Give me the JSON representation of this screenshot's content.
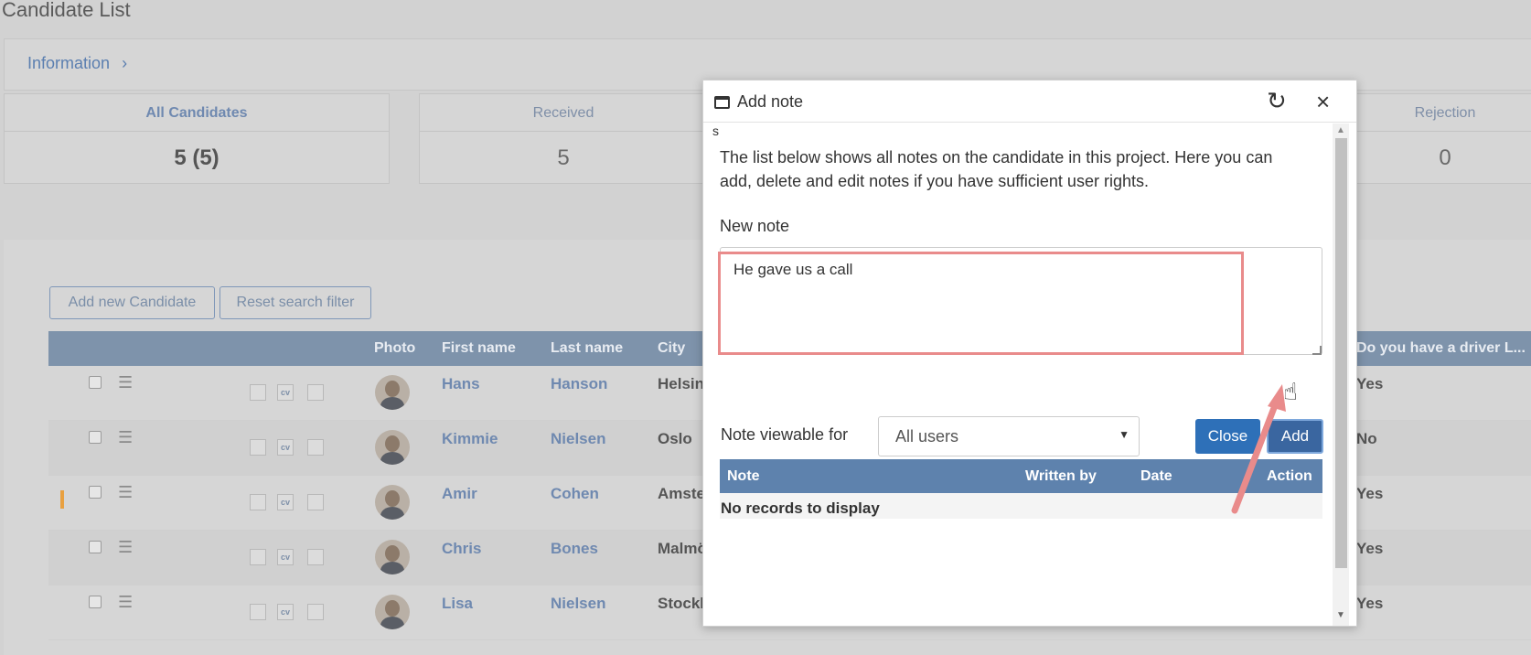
{
  "page": {
    "title": "Candidate List"
  },
  "info_bar": {
    "link_label": "Information",
    "chevron": "›"
  },
  "stats": [
    {
      "label": "All Candidates",
      "value": "5 (5)"
    },
    {
      "label": "Received",
      "value": "5"
    },
    {
      "label": "Rejection",
      "value": "0"
    }
  ],
  "toolbar": {
    "add_candidate_label": "Add new Candidate",
    "reset_filter_label": "Reset search filter"
  },
  "table": {
    "columns": [
      "Photo",
      "First name",
      "Last name",
      "City",
      "Do you have a driver L..."
    ],
    "rows": [
      {
        "first": "Hans",
        "last": "Hanson",
        "city": "Helsin",
        "driver": "Yes"
      },
      {
        "first": "Kimmie",
        "last": "Nielsen",
        "city": "Oslo",
        "driver": "No"
      },
      {
        "first": "Amir",
        "last": "Cohen",
        "city": "Amste",
        "driver": "Yes"
      },
      {
        "first": "Chris",
        "last": "Bones",
        "city": "Malmö",
        "driver": "Yes"
      },
      {
        "first": "Lisa",
        "last": "Nielsen",
        "city": "Stockl",
        "driver": "Yes"
      }
    ],
    "mini_icons": [
      "",
      "cv",
      ""
    ]
  },
  "modal": {
    "title": "Add note",
    "stray_text": "s",
    "intro": "The list below shows all notes on the candidate in this project. Here you can add, delete and edit notes if you have sufficient user rights.",
    "new_note_label": "New note",
    "note_value": "He gave us a call",
    "viewable_label": "Note viewable for",
    "viewable_selected": "All users",
    "close_label": "Close",
    "add_label": "Add",
    "notes_columns": [
      "Note",
      "Written by",
      "Date",
      "Action"
    ],
    "no_records": "No records to display"
  },
  "colors": {
    "accent": "#2e70b8",
    "header_blue": "#5e82ad",
    "highlight": "#e98b8b"
  }
}
